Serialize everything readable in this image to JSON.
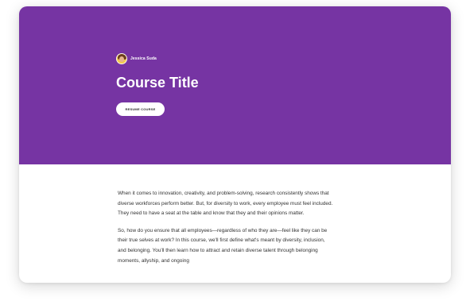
{
  "hero": {
    "background_color": "#7634a3",
    "author_name": "Jessica Suda",
    "course_title": "Course Title",
    "resume_label": "RESUME COURSE"
  },
  "content": {
    "paragraphs": [
      "When it comes to innovation, creativity, and problem-solving, research consistently shows that diverse workforces perform better. But, for diversity to work, every employee must feel included. They need to have a seat at the table and know that they and their opinions matter.",
      "So, how do you ensure that all employees—regardless of who they are—feel like they can be their true selves at work? In this course, we'll first define what's meant by diversity, inclusion, and belonging. You'll then learn how to attract and retain diverse talent through belonging moments, allyship, and ongoing"
    ]
  }
}
